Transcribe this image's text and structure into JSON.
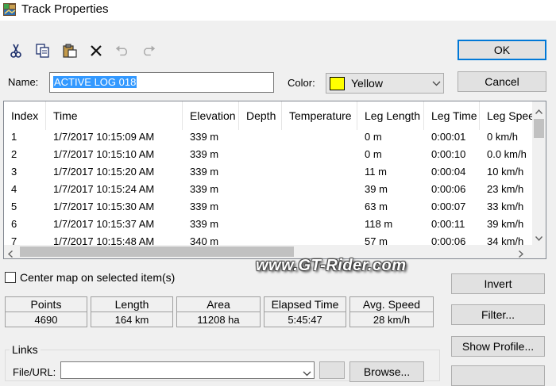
{
  "window": {
    "title": "Track Properties",
    "icon": "app-map-icon"
  },
  "toolbar": {
    "icons": [
      "cut-icon",
      "copy-icon",
      "paste-icon",
      "delete-icon",
      "undo-icon",
      "redo-icon"
    ]
  },
  "buttons": {
    "ok": "OK",
    "cancel": "Cancel",
    "invert": "Invert",
    "filter": "Filter...",
    "show_profile": "Show Profile...",
    "browse": "Browse..."
  },
  "name_field": {
    "label": "Name:",
    "value": "ACTIVE LOG 018"
  },
  "color_field": {
    "label": "Color:",
    "value": "Yellow",
    "swatch": "#ffff00"
  },
  "table": {
    "columns": [
      "Index",
      "Time",
      "Elevation",
      "Depth",
      "Temperature",
      "Leg Length",
      "Leg Time",
      "Leg Speed"
    ],
    "rows": [
      [
        "1",
        "1/7/2017 10:15:09 AM",
        "339 m",
        "",
        "",
        "0 m",
        "0:00:01",
        "0 km/h"
      ],
      [
        "2",
        "1/7/2017 10:15:10 AM",
        "339 m",
        "",
        "",
        "0 m",
        "0:00:10",
        "0.0 km/h"
      ],
      [
        "3",
        "1/7/2017 10:15:20 AM",
        "339 m",
        "",
        "",
        "11 m",
        "0:00:04",
        "10 km/h"
      ],
      [
        "4",
        "1/7/2017 10:15:24 AM",
        "339 m",
        "",
        "",
        "39 m",
        "0:00:06",
        "23 km/h"
      ],
      [
        "5",
        "1/7/2017 10:15:30 AM",
        "339 m",
        "",
        "",
        "63 m",
        "0:00:07",
        "33 km/h"
      ],
      [
        "6",
        "1/7/2017 10:15:37 AM",
        "339 m",
        "",
        "",
        "118 m",
        "0:00:11",
        "39 km/h"
      ],
      [
        "7",
        "1/7/2017 10:15:48 AM",
        "340 m",
        "",
        "",
        "57 m",
        "0:00:06",
        "34 km/h"
      ]
    ]
  },
  "center_map": {
    "label": "Center map on selected item(s)",
    "checked": false
  },
  "watermark": "www.GT-Rider.com",
  "stats": {
    "labels": [
      "Points",
      "Length",
      "Area",
      "Elapsed Time",
      "Avg. Speed"
    ],
    "values": [
      "4690",
      "164 km",
      "11208 ha",
      "5:45:47",
      "28 km/h"
    ]
  },
  "links": {
    "group_label": "Links",
    "file_url_label": "File/URL:"
  }
}
